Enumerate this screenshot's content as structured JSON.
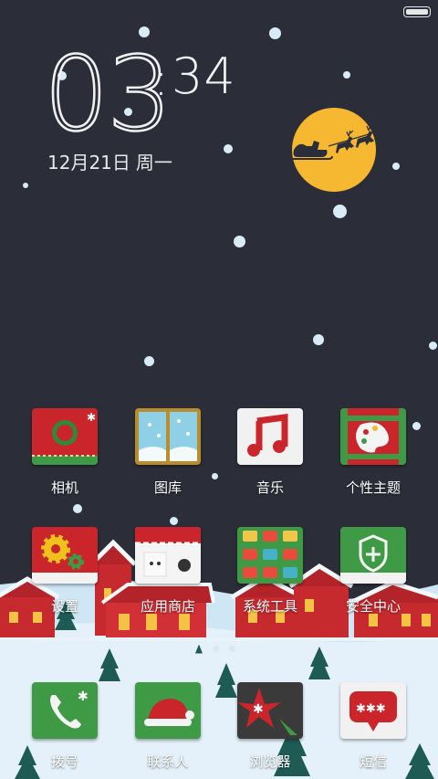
{
  "clock": {
    "hours": "03",
    "colon": ":",
    "minutes": "34",
    "date": "12月21日",
    "weekday": "周一"
  },
  "apps": {
    "camera": "相机",
    "gallery": "图库",
    "music": "音乐",
    "themes": "个性主题",
    "settings": "设置",
    "app_store": "应用商店",
    "system_tools": "系统工具",
    "security": "安全中心",
    "dialer": "拨号",
    "contacts": "联系人",
    "browser": "浏览器",
    "messages": "短信"
  },
  "colors": {
    "background": "#2b2e38",
    "moon": "#f6b731",
    "red": "#c9252b",
    "green": "#3f9a45",
    "snow": "#d7ecf8"
  },
  "icons": {
    "camera": "camera-icon",
    "gallery": "gallery-window-icon",
    "music": "music-note-icon",
    "themes": "palette-icon",
    "settings": "gear-icon",
    "app_store": "shop-house-icon",
    "system_tools": "tools-grid-icon",
    "security": "shield-plus-icon",
    "dialer": "phone-icon",
    "contacts": "santa-hat-icon",
    "browser": "star-compass-icon",
    "messages": "chat-bubble-icon"
  }
}
